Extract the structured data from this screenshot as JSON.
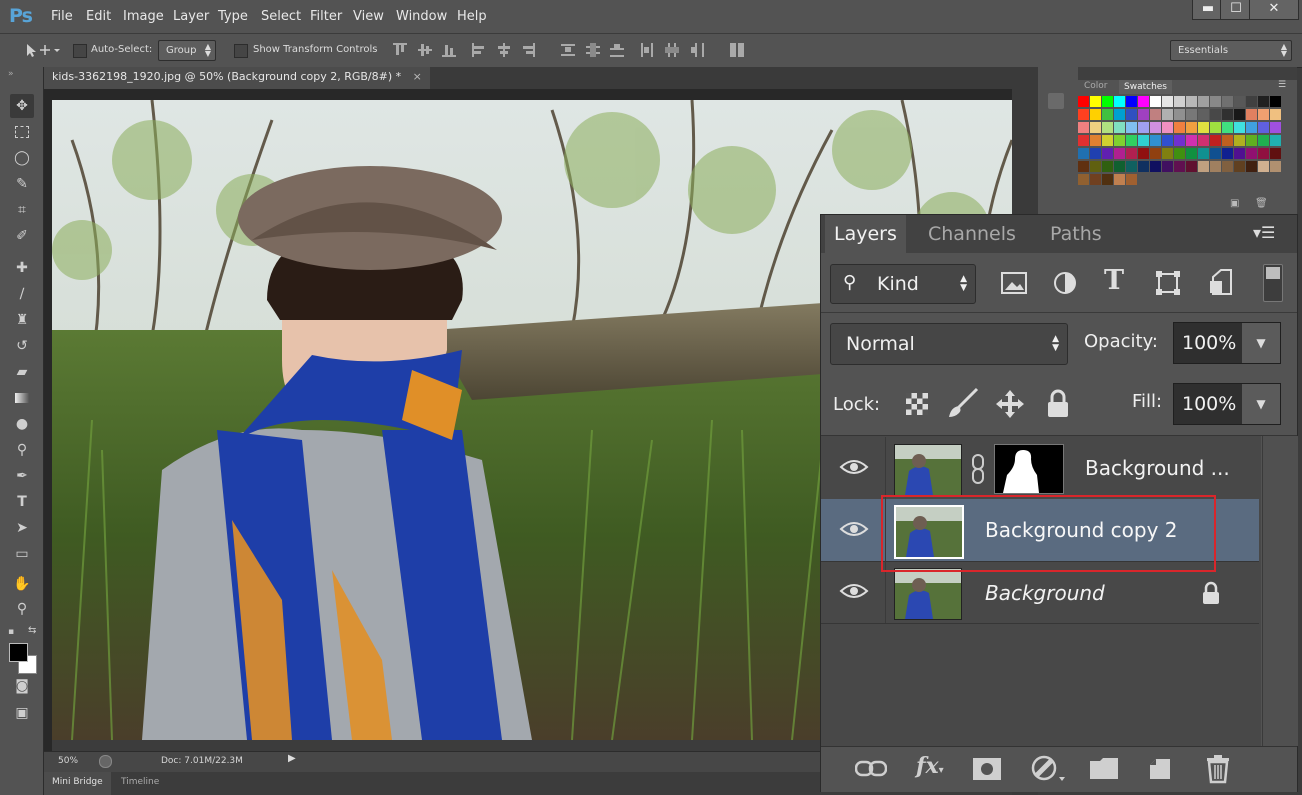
{
  "app": {
    "logo": "Ps"
  },
  "menu": [
    "File",
    "Edit",
    "Image",
    "Layer",
    "Type",
    "Select",
    "Filter",
    "View",
    "Window",
    "Help"
  ],
  "window_controls": {
    "minimize": "▬",
    "maximize": "☐",
    "close": "✕"
  },
  "options": {
    "auto_select_label": "Auto-Select:",
    "auto_select_value": "Group",
    "show_transform_label": "Show Transform Controls",
    "workspace": "Essentials"
  },
  "document": {
    "tab_title": "kids-3362198_1920.jpg @ 50% (Background copy 2, RGB/8#) *",
    "close": "×"
  },
  "status": {
    "zoom": "50%",
    "doc": "Doc: 7.01M/22.3M"
  },
  "bottom_tabs": [
    "Mini Bridge",
    "Timeline"
  ],
  "swatch_panel": {
    "tabs": [
      "Color",
      "Swatches"
    ],
    "active": "Swatches"
  },
  "layers_panel": {
    "tabs": [
      "Layers",
      "Channels",
      "Paths"
    ],
    "active_tab": "Layers",
    "filter_kind": "Kind",
    "blend_mode": "Normal",
    "opacity_label": "Opacity:",
    "opacity_value": "100%",
    "lock_label": "Lock:",
    "fill_label": "Fill:",
    "fill_value": "100%",
    "layers": [
      {
        "name": "Background ...",
        "has_mask": true,
        "selected": false,
        "italic": false,
        "locked": false
      },
      {
        "name": "Background copy 2",
        "has_mask": false,
        "selected": true,
        "italic": false,
        "locked": false
      },
      {
        "name": "Background",
        "has_mask": false,
        "selected": false,
        "italic": true,
        "locked": true
      }
    ]
  },
  "colors": {
    "app_bg": "#535353",
    "panel_bg": "#535353",
    "selected_layer": "#5a6b80",
    "highlight_box": "#d9262b",
    "ps_blue": "#58a4d8"
  }
}
